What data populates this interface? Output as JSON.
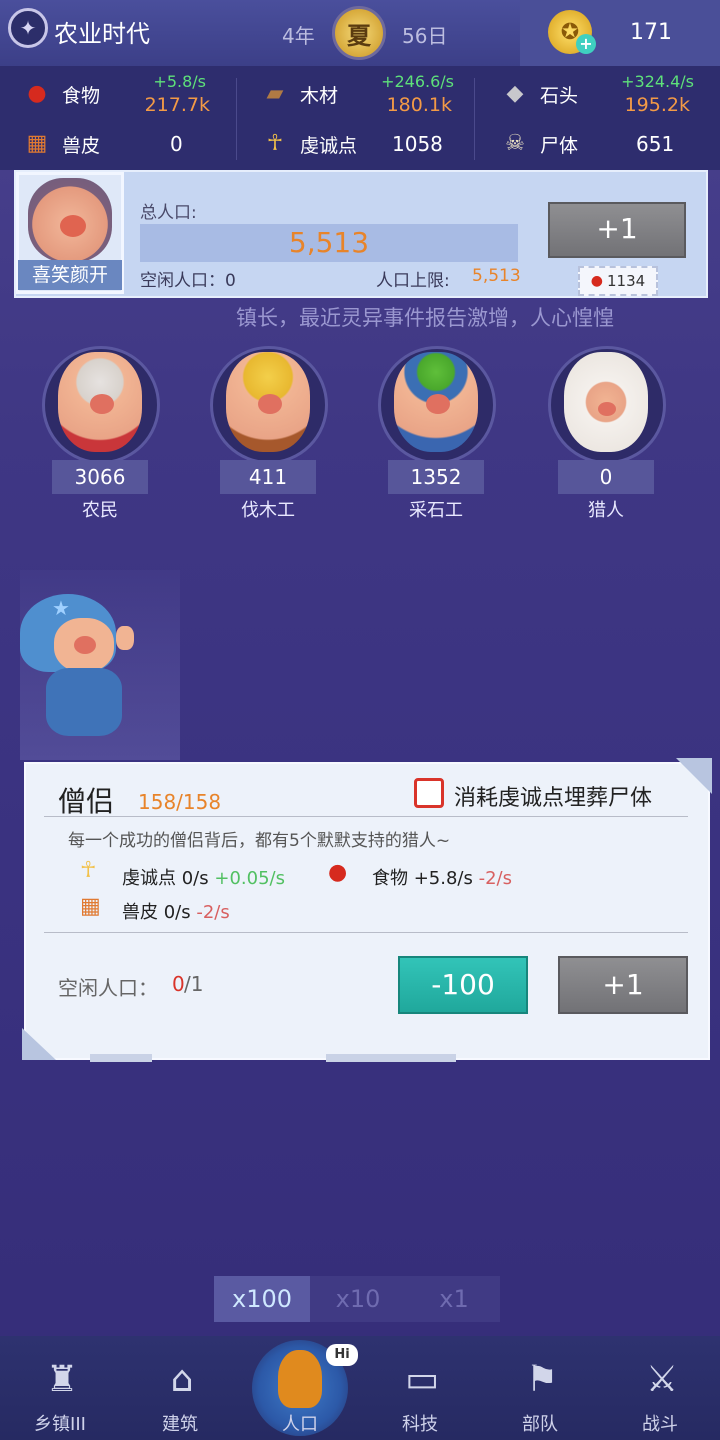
{
  "header": {
    "era": "农业时代",
    "year": "4年",
    "season": "夏",
    "day": "56日",
    "gems": "171"
  },
  "resources": [
    {
      "name": "食物",
      "rate": "+5.8/s",
      "value": "217.7k"
    },
    {
      "name": "木材",
      "rate": "+246.6/s",
      "value": "180.1k"
    },
    {
      "name": "石头",
      "rate": "+324.4/s",
      "value": "195.2k"
    }
  ],
  "resources_row2": [
    {
      "name": "兽皮",
      "value": "0"
    },
    {
      "name": "虔诚点",
      "value": "1058"
    },
    {
      "name": "尸体",
      "value": "651"
    }
  ],
  "population": {
    "mayor_mood": "喜笑颜开",
    "total_label": "总人口:",
    "total": "5,513",
    "idle_label": "空闲人口：0",
    "cap_label": "人口上限:",
    "cap": "5,513",
    "plus_label": "+1",
    "cost": "1134"
  },
  "ticker": "镇长，最近灵异事件报告激增，人心惶惶",
  "workers": [
    {
      "name": "农民",
      "count": "3066"
    },
    {
      "name": "伐木工",
      "count": "411"
    },
    {
      "name": "采石工",
      "count": "1352"
    },
    {
      "name": "猎人",
      "count": "0"
    }
  ],
  "job": {
    "title": "僧侣",
    "count": "158/158",
    "bury_label": "消耗虔诚点埋葬尸体",
    "desc": "每一个成功的僧侣背后，都有5个默默支持的猎人~",
    "stat_piety": "虔诚点 0/s",
    "stat_piety_gain": "+0.05/s",
    "stat_food": "食物 +5.8/s",
    "stat_food_cost": "-2/s",
    "stat_hide": "兽皮 0/s",
    "stat_hide_cost": "-2/s",
    "idle_label": "空闲人口：",
    "idle_used": "0",
    "idle_total": "/1",
    "minus_label": "-100",
    "plus_label": "+1"
  },
  "multipliers": [
    "x100",
    "x10",
    "x1"
  ],
  "nav": [
    {
      "label": "乡镇III",
      "icon": "town-icon"
    },
    {
      "label": "建筑",
      "icon": "house-icon"
    },
    {
      "label": "人口",
      "icon": "people-icon"
    },
    {
      "label": "科技",
      "icon": "book-icon"
    },
    {
      "label": "部队",
      "icon": "banner-icon"
    },
    {
      "label": "战斗",
      "icon": "crossed-swords-icon"
    }
  ],
  "hi_bubble": "Hi",
  "colors": {
    "orange": "#e8842a",
    "green": "#5ee07a",
    "teal": "#20a89c",
    "red": "#d9342a",
    "bg": "#3f3784"
  }
}
